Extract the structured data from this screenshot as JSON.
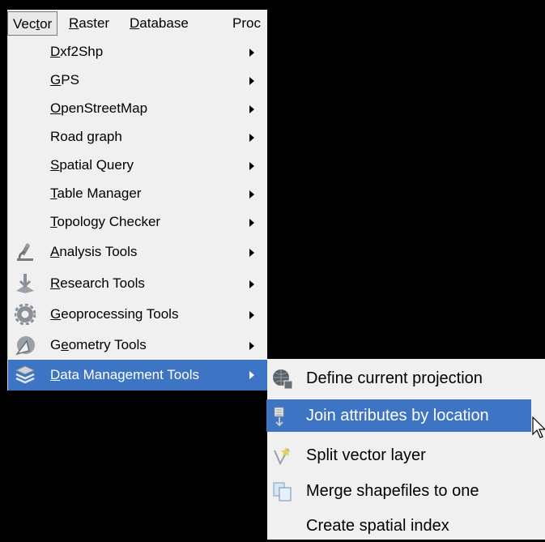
{
  "menubar": {
    "items": [
      {
        "pre": "Vec",
        "acc": "t",
        "post": "or"
      },
      {
        "pre": "",
        "acc": "R",
        "post": "aster"
      },
      {
        "pre": "",
        "acc": "D",
        "post": "atabase"
      },
      {
        "pre": "Proc",
        "acc": "",
        "post": ""
      }
    ]
  },
  "vector_menu": {
    "items": [
      {
        "pre": "",
        "acc": "D",
        "post": "xf2Shp",
        "icon": "none"
      },
      {
        "pre": "",
        "acc": "G",
        "post": "PS",
        "icon": "none"
      },
      {
        "pre": "",
        "acc": "O",
        "post": "penStreetMap",
        "icon": "none"
      },
      {
        "pre": "Road graph",
        "acc": "",
        "post": "",
        "icon": "none"
      },
      {
        "pre": "",
        "acc": "S",
        "post": "patial Query",
        "icon": "none"
      },
      {
        "pre": "",
        "acc": "T",
        "post": "able Manager",
        "icon": "none"
      },
      {
        "pre": "",
        "acc": "T",
        "post": "opology Checker",
        "icon": "none"
      },
      {
        "pre": "",
        "acc": "A",
        "post": "nalysis Tools",
        "icon": "microscope-icon"
      },
      {
        "pre": "",
        "acc": "R",
        "post": "esearch Tools",
        "icon": "research-icon"
      },
      {
        "pre": "",
        "acc": "G",
        "post": "eoprocessing Tools",
        "icon": "gear-icon"
      },
      {
        "pre": "G",
        "acc": "e",
        "post": "ometry Tools",
        "icon": "geometry-icon"
      },
      {
        "pre": "",
        "acc": "D",
        "post": "ata Management Tools",
        "icon": "layers-icon"
      }
    ],
    "highlighted": "Data Management Tools"
  },
  "data_management_submenu": {
    "items": [
      {
        "label": "Define current projection",
        "icon": "globe-icon"
      },
      {
        "label": "Join attributes by location",
        "icon": "join-icon"
      },
      {
        "label": "Split vector layer",
        "icon": "split-icon"
      },
      {
        "label": "Merge shapefiles to one",
        "icon": "merge-icon"
      },
      {
        "label": "Create spatial index",
        "icon": "none"
      }
    ],
    "highlighted": "Join attributes by location"
  },
  "colors": {
    "menu_bg": "#f0f0f0",
    "highlight": "#3d75c4",
    "background": "#000000"
  }
}
